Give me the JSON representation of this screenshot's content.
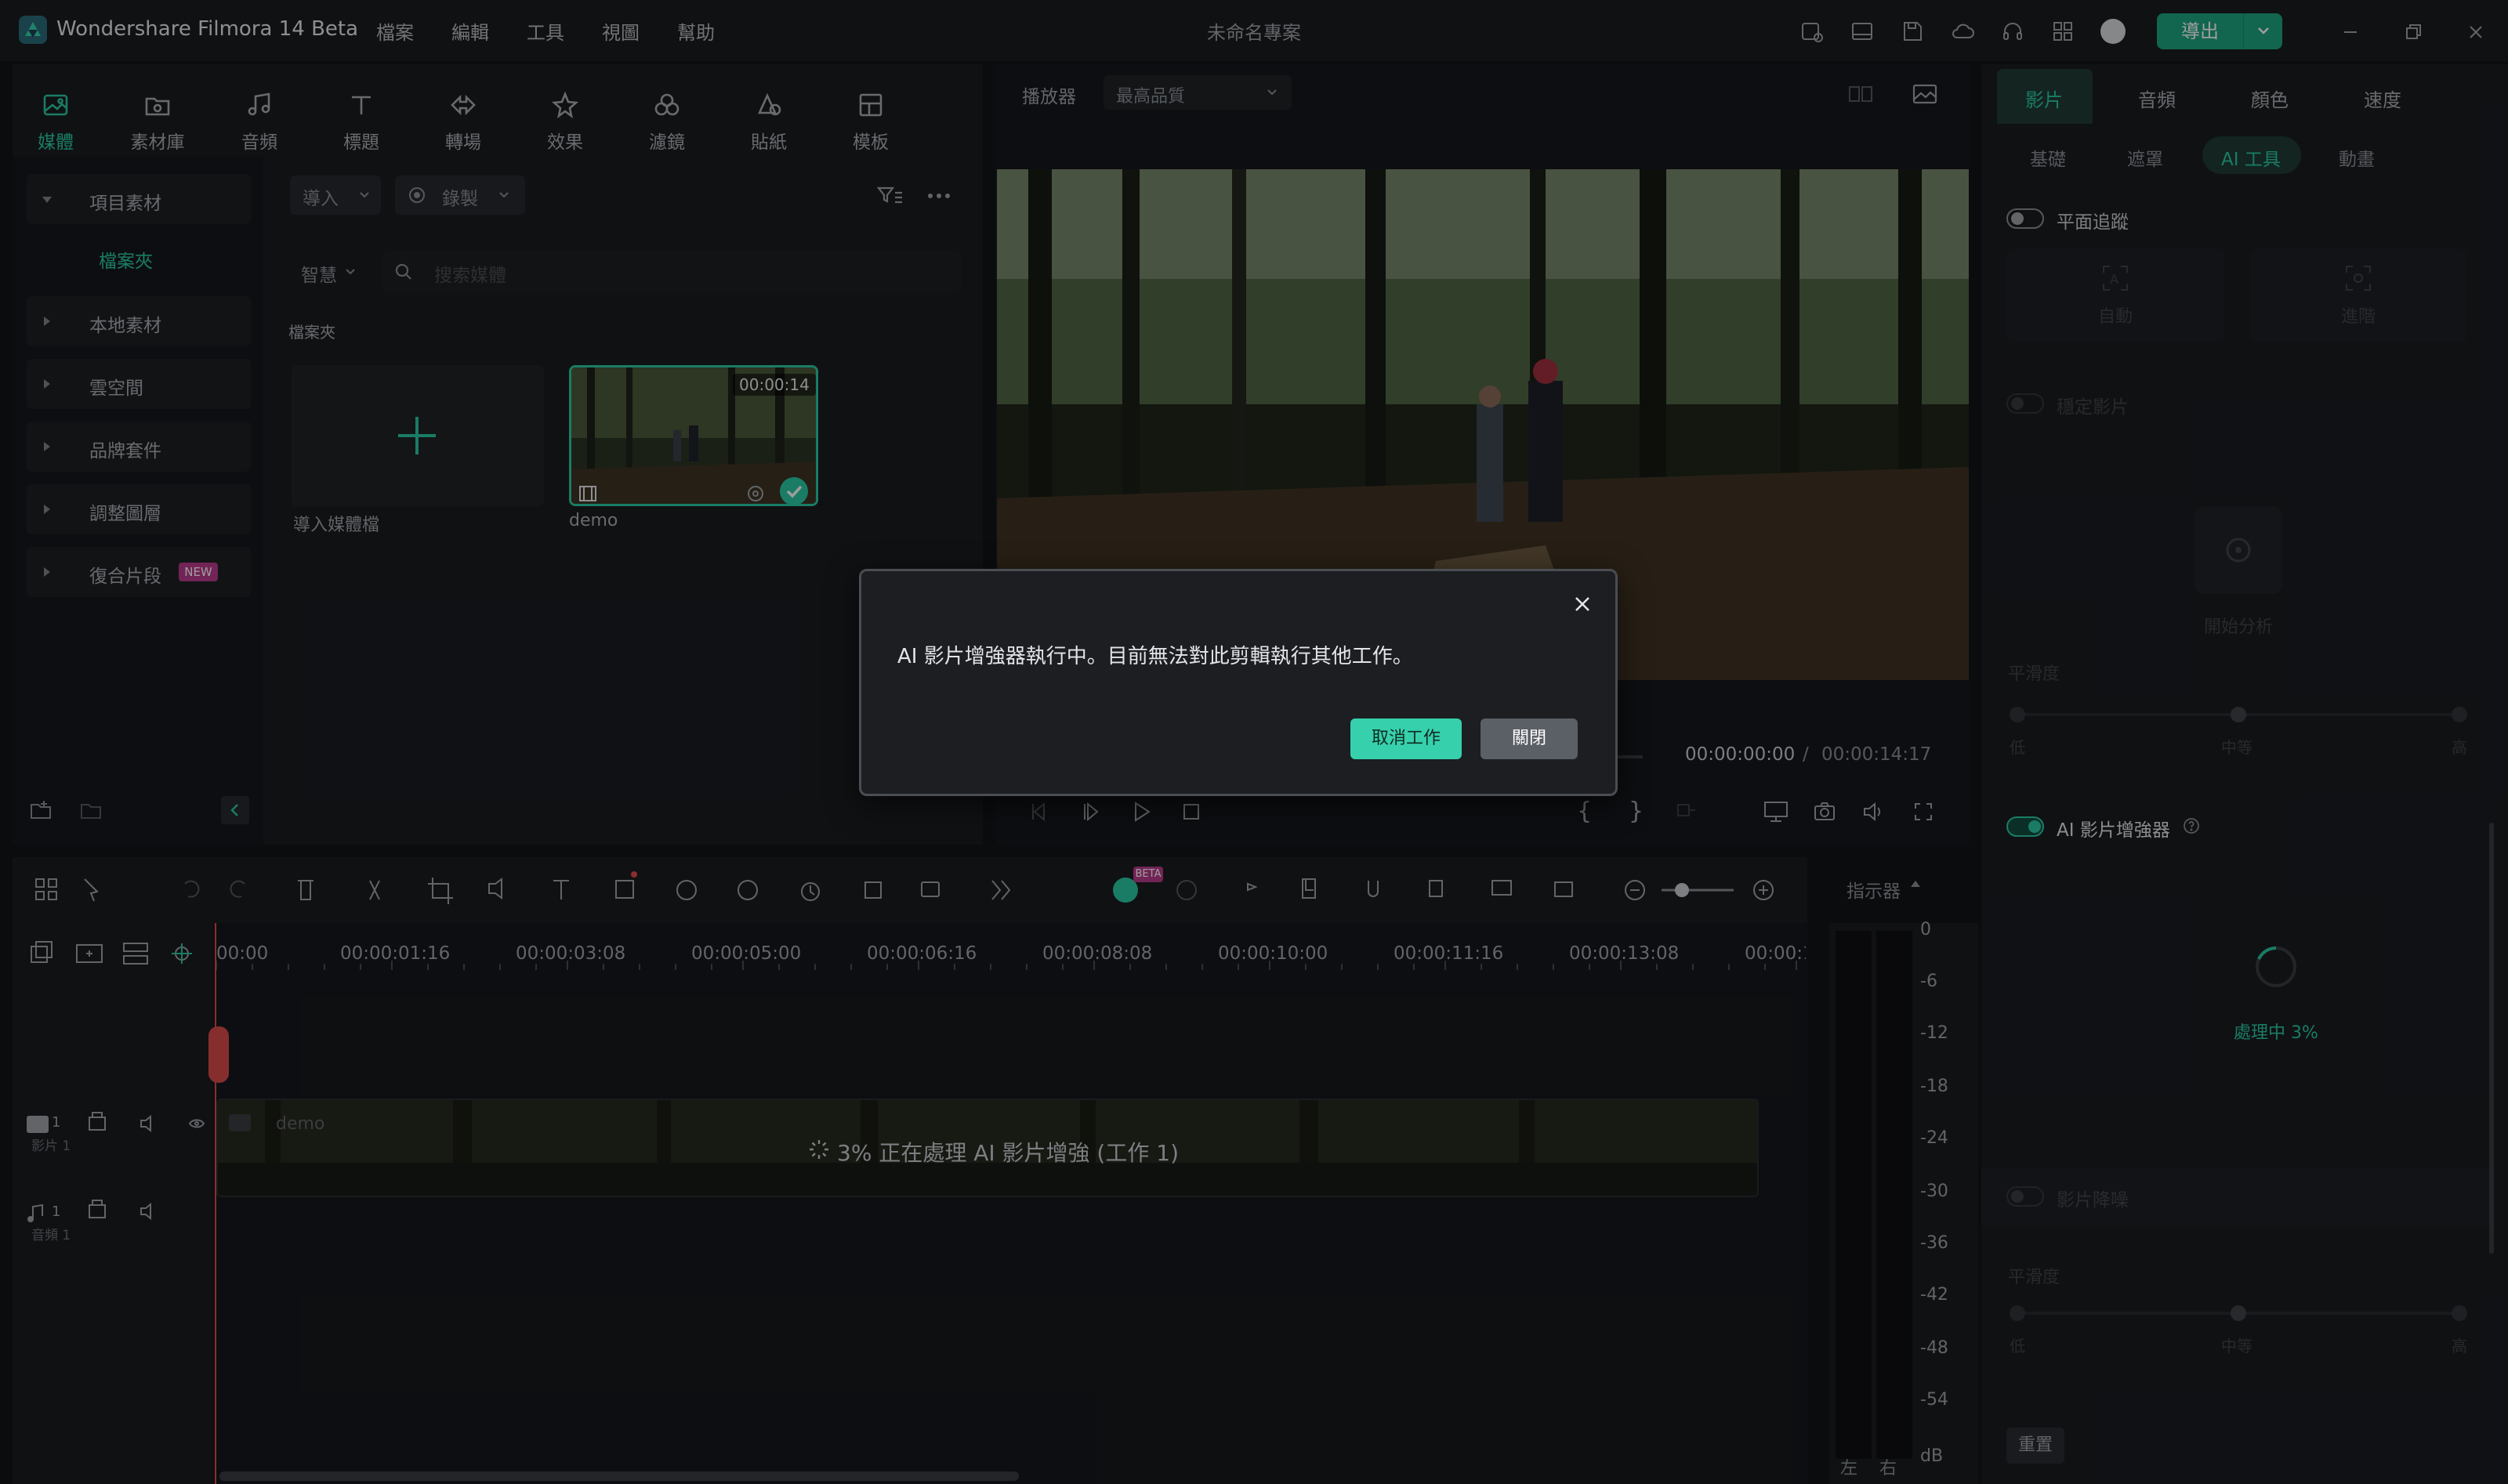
{
  "app": {
    "title": "Wondershare Filmora 14 Beta",
    "project_name": "未命名專案",
    "menu": [
      "檔案",
      "編輯",
      "工具",
      "視圖",
      "幫助"
    ],
    "export_label": "導出"
  },
  "media_tabs": [
    {
      "label": "媒體",
      "icon": "media-icon",
      "active": true
    },
    {
      "label": "素材庫",
      "icon": "stock-library-icon"
    },
    {
      "label": "音頻",
      "icon": "music-note-icon"
    },
    {
      "label": "標題",
      "icon": "text-title-icon"
    },
    {
      "label": "轉場",
      "icon": "transition-icon"
    },
    {
      "label": "效果",
      "icon": "effects-star-icon"
    },
    {
      "label": "濾鏡",
      "icon": "filter-icon"
    },
    {
      "label": "貼紙",
      "icon": "sticker-icon"
    },
    {
      "label": "模板",
      "icon": "template-icon"
    }
  ],
  "media_sidebar": {
    "items": [
      "項目素材",
      "本地素材",
      "雲空間",
      "品牌套件",
      "調整圖層",
      "復合片段"
    ],
    "sub_item": "檔案夾",
    "new_badge": "NEW"
  },
  "media_browser": {
    "import_label": "導入",
    "record_label": "錄製",
    "sort_label": "智慧",
    "search_placeholder": "搜索媒體",
    "folder_label": "檔案夾",
    "import_tile_label": "導入媒體檔",
    "clip": {
      "name": "demo",
      "duration": "00:00:14"
    }
  },
  "player": {
    "label": "播放器",
    "quality": "最高品質",
    "current_time": "00:00:00:00",
    "separator": "/",
    "total_time": "00:00:14:17"
  },
  "properties": {
    "tabs": [
      "影片",
      "音頻",
      "顏色",
      "速度"
    ],
    "subtabs": [
      "基礎",
      "遮罩",
      "AI 工具",
      "動畫"
    ],
    "planar_tracking": "平面追蹤",
    "track_buttons": [
      "自動",
      "進階"
    ],
    "stabilize": "穩定影片",
    "analyze": "開始分析",
    "smoothness": "平滑度",
    "ai_enhancer": "AI 影片增強器",
    "processing": "處理中 3%",
    "denoise": "影片降噪",
    "reset": "重置",
    "slider_marks": [
      "低",
      "中等",
      "高"
    ]
  },
  "timeline": {
    "ruler": [
      "00:00",
      "00:00:01:16",
      "00:00:03:08",
      "00:00:05:00",
      "00:00:06:16",
      "00:00:08:08",
      "00:00:10:00",
      "00:00:11:16",
      "00:00:13:08",
      "00:00:1"
    ],
    "video_track": {
      "index": "1",
      "label": "影片 1"
    },
    "audio_track": {
      "index": "1",
      "label": "音頻 1"
    },
    "clip_name": "demo",
    "clip_status": "3% 正在處理 AI 影片增強 (工作 1)",
    "meter_label": "指示器",
    "meter_scale": [
      "0",
      "-6",
      "-12",
      "-18",
      "-24",
      "-30",
      "-36",
      "-42",
      "-48",
      "-54",
      "dB"
    ],
    "meter_channels": [
      "左",
      "右"
    ],
    "ai_badge": "BETA"
  },
  "dialog": {
    "message": "AI 影片增強器執行中。目前無法對此剪輯執行其他工作。",
    "cancel_label": "取消工作",
    "close_label": "關閉"
  },
  "colors": {
    "accent": "#2bc9a3",
    "export": "#1ea37e",
    "playhead": "#e04a4a",
    "background": "#121418"
  }
}
